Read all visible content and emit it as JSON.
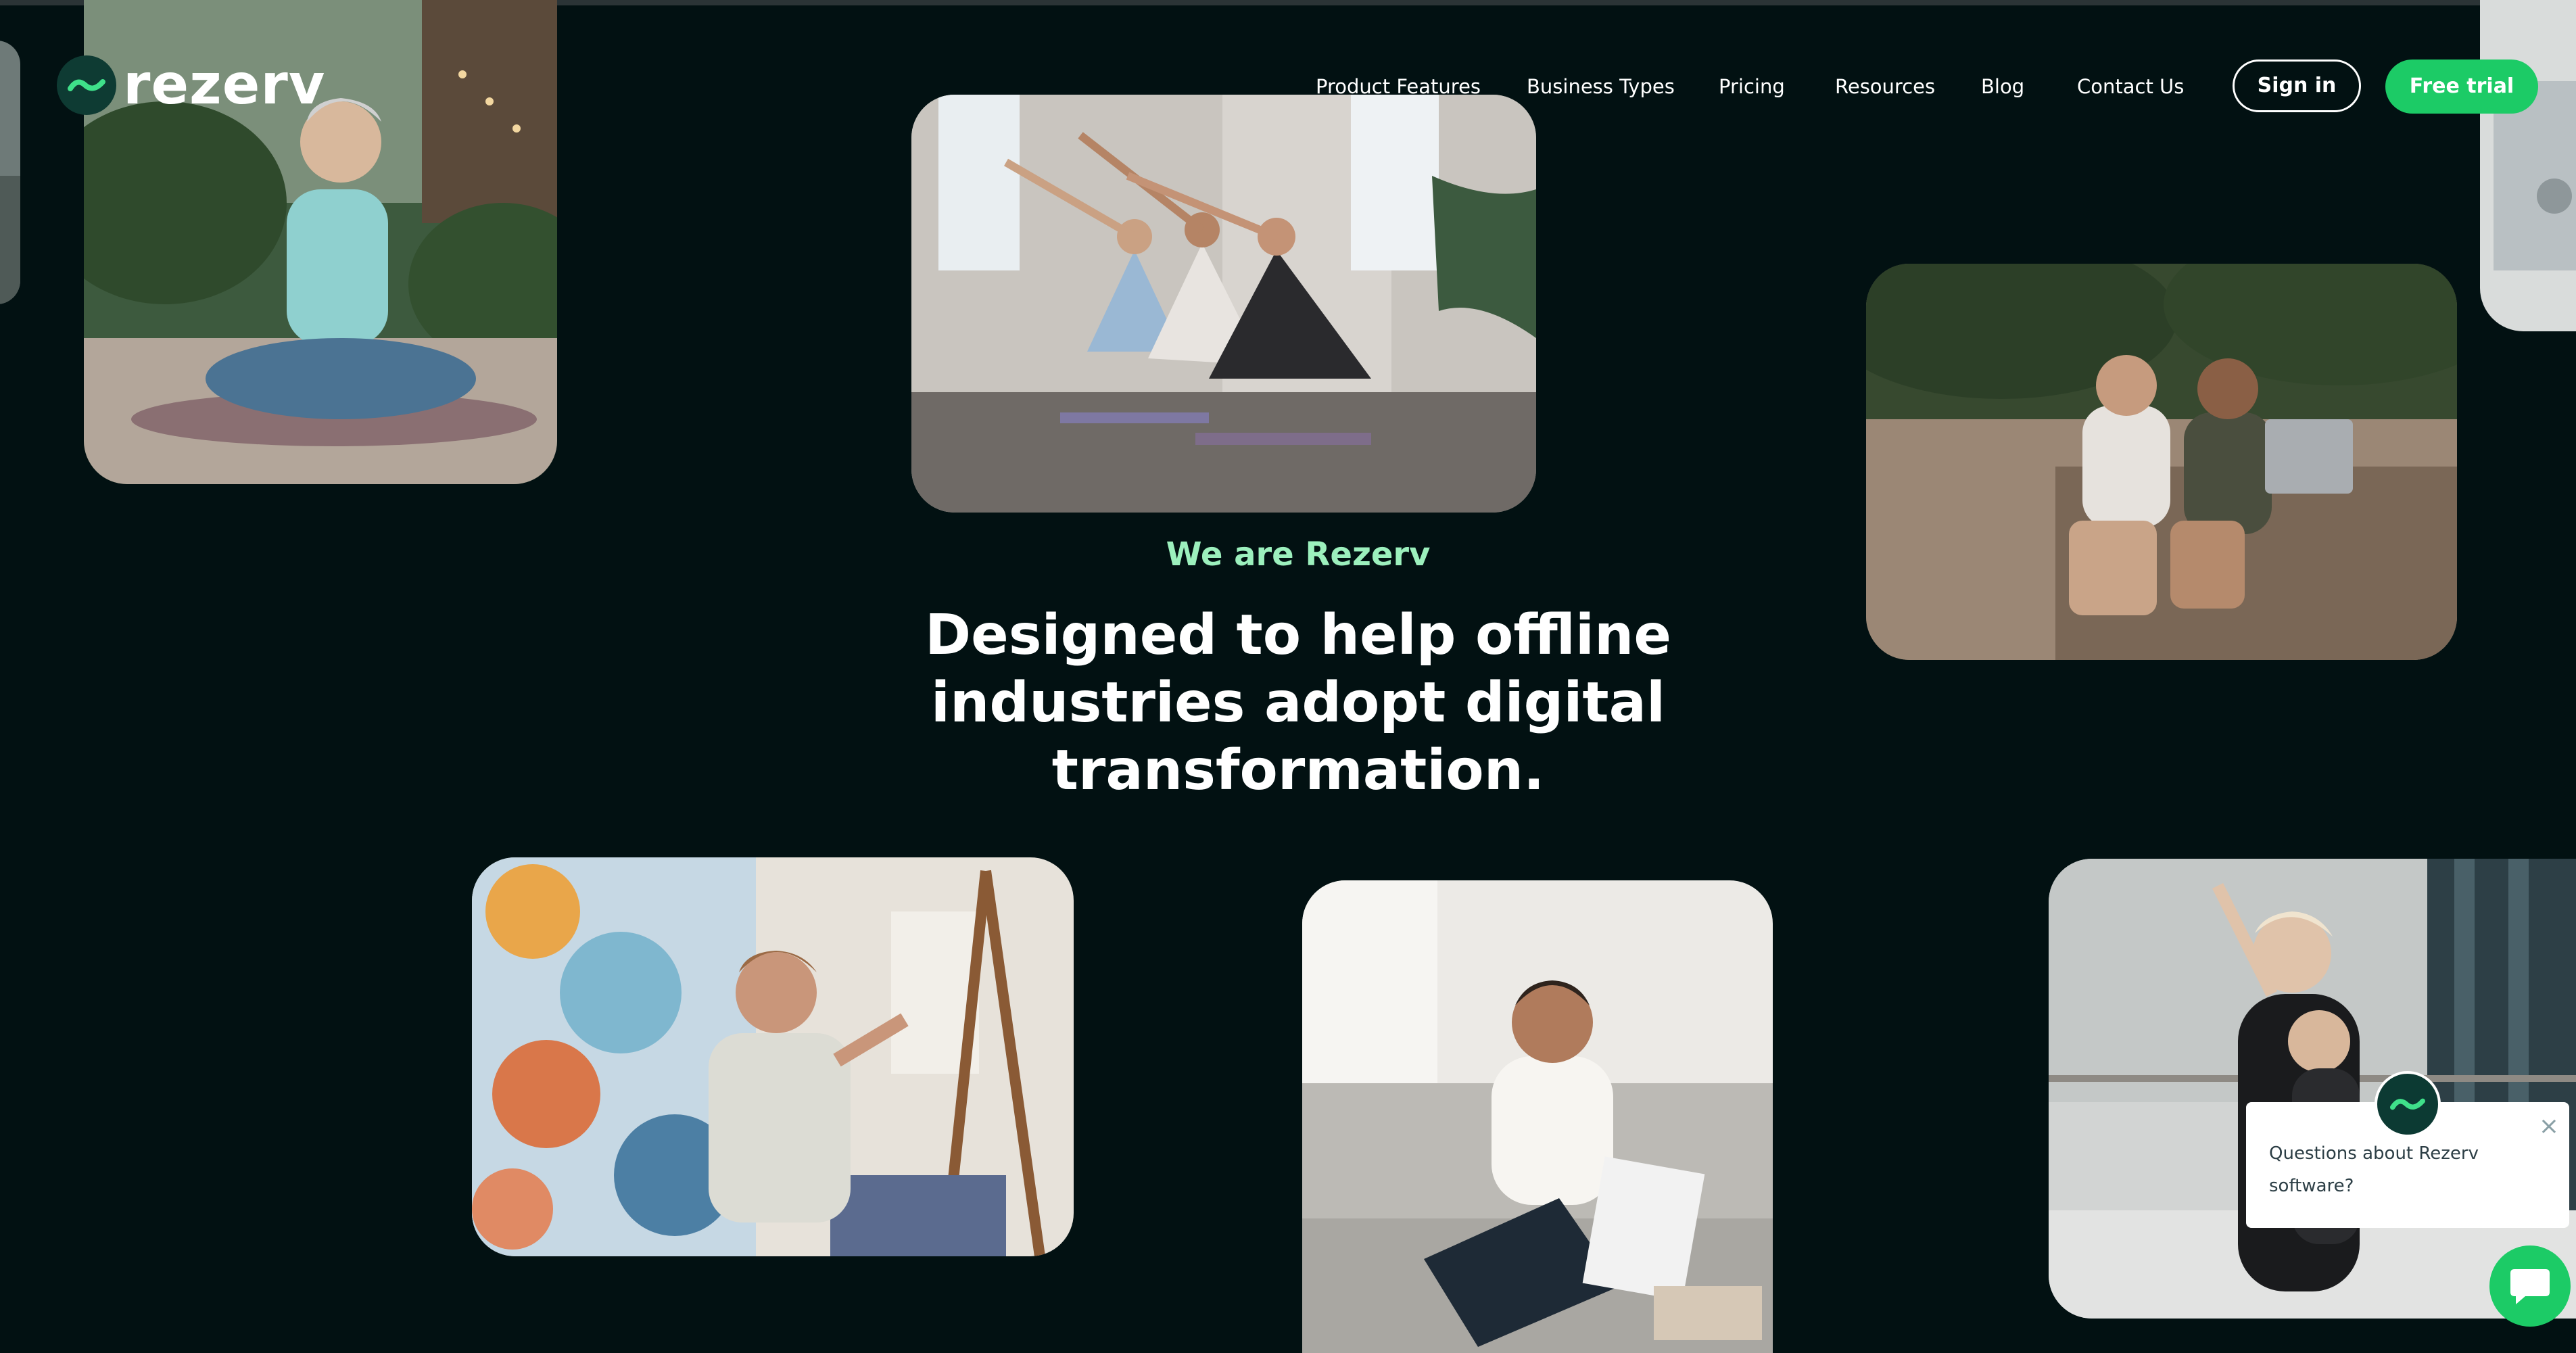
{
  "brand": {
    "name": "rezerv",
    "accent": "#1ccb66",
    "background": "#021112",
    "eyebrow_color": "#9cf0bd"
  },
  "nav": {
    "items": [
      {
        "label": "Product Features"
      },
      {
        "label": "Business Types"
      },
      {
        "label": "Pricing"
      },
      {
        "label": "Resources"
      },
      {
        "label": "Blog"
      },
      {
        "label": "Contact Us"
      }
    ],
    "sign_in": "Sign in",
    "free_trial": "Free trial"
  },
  "hero": {
    "eyebrow": "We are Rezerv",
    "headline": "Designed to help offline industries adopt digital transformation."
  },
  "photos": [
    {
      "name": "woman-meditating-photo",
      "icon": "photo"
    },
    {
      "name": "group-yoga-class-photo",
      "icon": "photo"
    },
    {
      "name": "women-with-laptop-photo",
      "icon": "photo"
    },
    {
      "name": "artist-painting-photo",
      "icon": "photo"
    },
    {
      "name": "man-on-sofa-photo",
      "icon": "photo"
    },
    {
      "name": "ballet-lesson-photo",
      "icon": "photo"
    }
  ],
  "chat": {
    "message": "Questions about Rezerv software?",
    "close_icon": "close-icon",
    "launcher_icon": "chat-bubble-icon"
  }
}
